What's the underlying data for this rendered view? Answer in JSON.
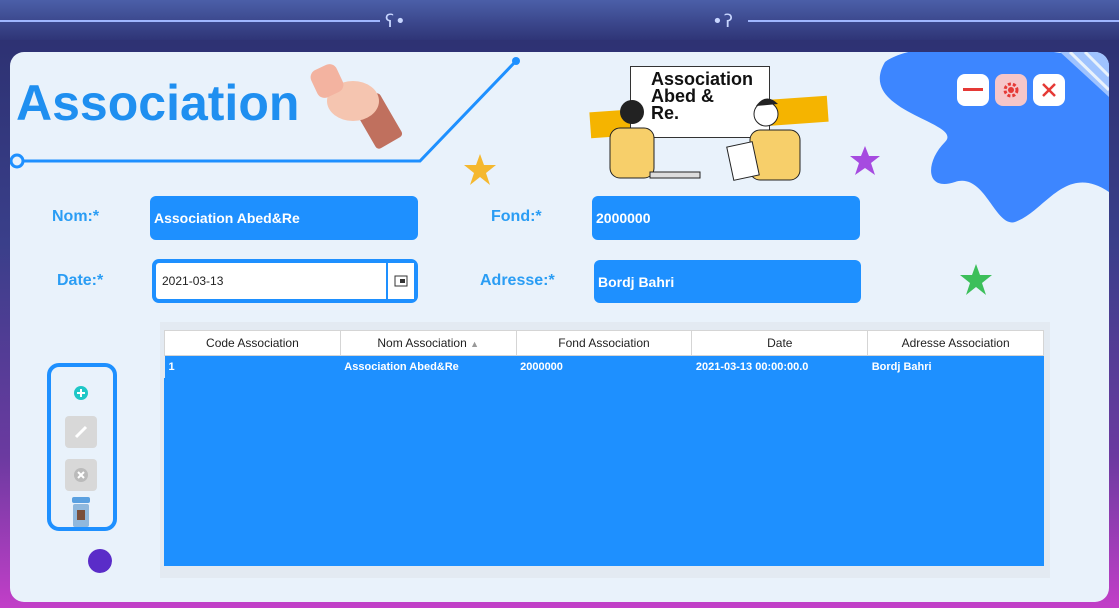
{
  "app": {
    "title": "Association"
  },
  "logo": {
    "line1": "Association",
    "line2": "Abed &",
    "line3": "Re."
  },
  "window_buttons": {
    "minimize": "minimize",
    "settings": "settings",
    "close": "close"
  },
  "form": {
    "nom": {
      "label": "Nom:*",
      "value": "Association Abed&Re"
    },
    "fond": {
      "label": "Fond:*",
      "value": "2000000"
    },
    "date": {
      "label": "Date:*",
      "value": "2021-03-13"
    },
    "adresse": {
      "label": "Adresse:*",
      "value": "Bordj Bahri"
    }
  },
  "table": {
    "columns": [
      "Code Association",
      "Nom Association",
      "Fond Association",
      "Date",
      "Adresse Association"
    ],
    "sorted_column": "Nom Association",
    "rows": [
      [
        "1",
        "Association Abed&Re",
        "2000000",
        "2021-03-13 00:00:00.0",
        "Bordj Bahri"
      ]
    ]
  },
  "toolbar": {
    "add_icon": "plus-circle-icon",
    "edit_icon": "pencil-icon",
    "delete_icon": "x-circle-icon",
    "trash_icon": "trash-icon"
  },
  "colors": {
    "accent": "#1e90ff",
    "title": "#1f8ff0",
    "label": "#2a9df4",
    "panel": "#e9f2fb",
    "close": "#e53935"
  }
}
